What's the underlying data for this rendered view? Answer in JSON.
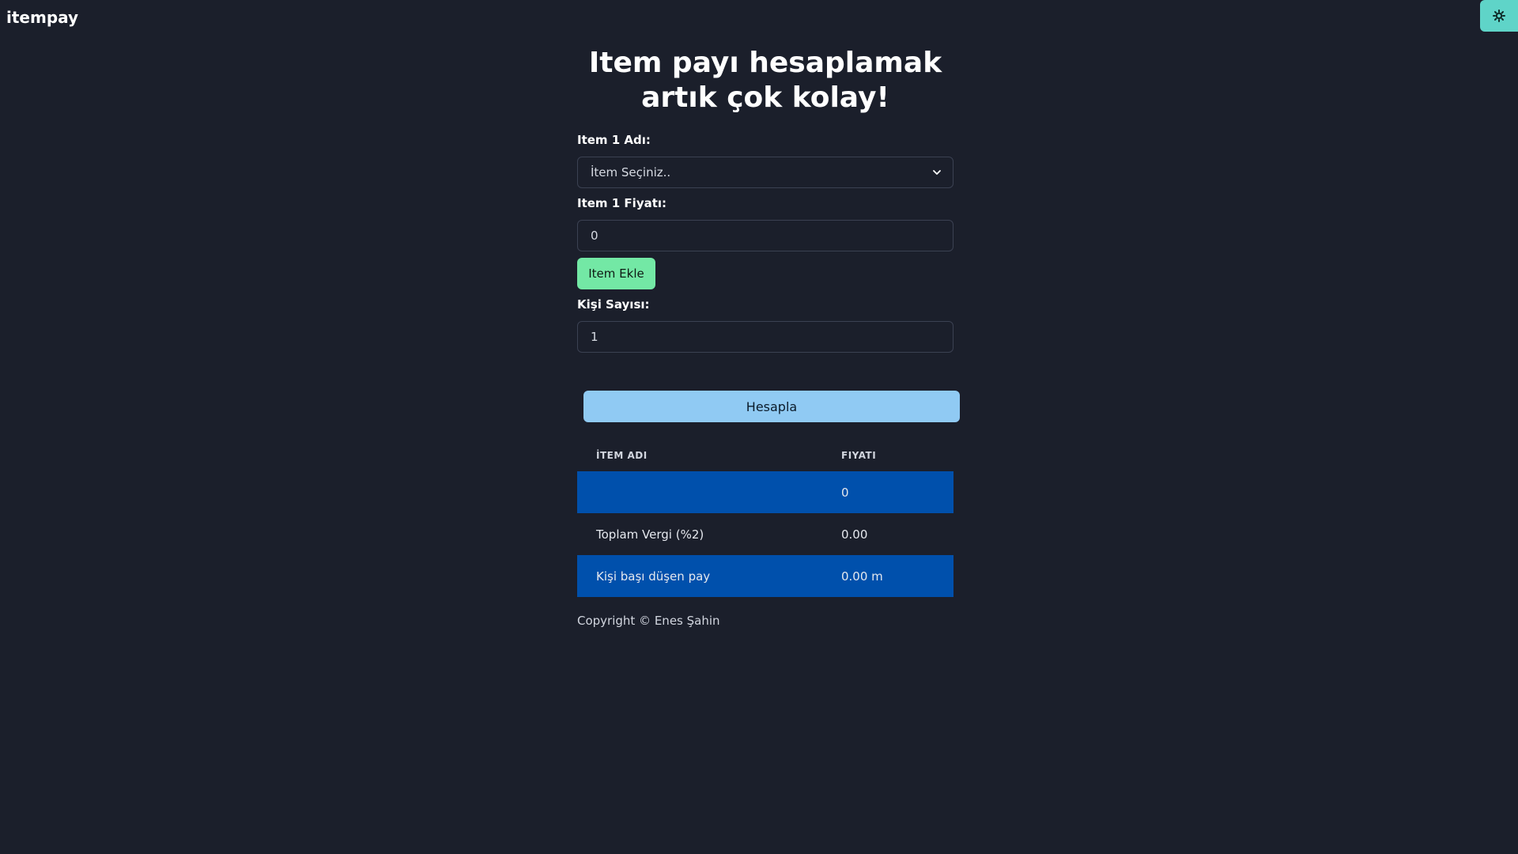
{
  "app": {
    "brand": "itempay",
    "theme_icon": "gear-icon"
  },
  "main": {
    "title": "Item payı hesaplamak artık çok kolay!",
    "item_name_label": "Item 1 Adı:",
    "item_select": {
      "selected": "İtem Seçiniz.."
    },
    "item_price_label": "Item 1 Fiyatı:",
    "item_price_value": "0",
    "add_button": "Item Ekle",
    "person_count_label": "Kişi Sayısı:",
    "person_count_value": "1",
    "calculate_button": "Hesapla"
  },
  "table": {
    "headers": [
      "İTEM ADI",
      "FIYATI"
    ],
    "rows": [
      {
        "name": "",
        "price": "0"
      },
      {
        "name": "Toplam Vergi (%2)",
        "price": "0.00"
      },
      {
        "name": "Kişi başı düşen pay",
        "price": "0.00 m"
      }
    ]
  },
  "footer": {
    "copyright": "Copyright © Enes Şahin"
  },
  "colors": {
    "background": "#1b1f2b",
    "add_button": "#73e8a5",
    "calculate_button": "#90caf3",
    "row_highlight": "#0050ac",
    "theme_toggle": "#5fd4c8"
  }
}
